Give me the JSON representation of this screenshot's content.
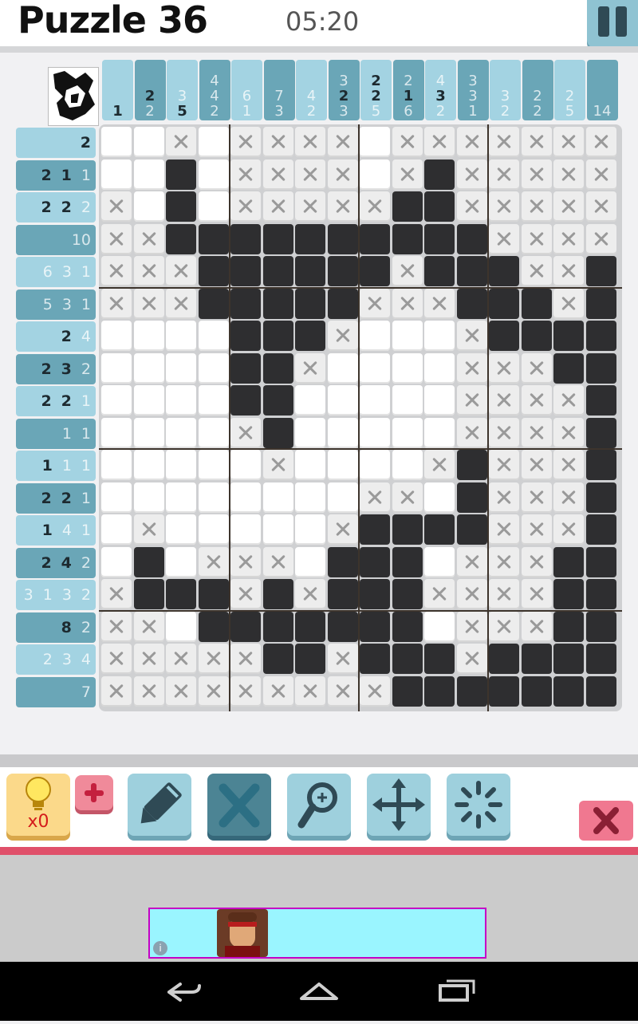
{
  "header": {
    "title": "Puzzle 36",
    "timer": "05:20"
  },
  "column_clues": [
    [
      "1"
    ],
    [
      "2",
      "2"
    ],
    [
      "3",
      "5"
    ],
    [
      "4",
      "4",
      "2"
    ],
    [
      "6",
      "1"
    ],
    [
      "7",
      "3"
    ],
    [
      "4",
      "2"
    ],
    [
      "3",
      "2",
      "3"
    ],
    [
      "2",
      "2",
      "5"
    ],
    [
      "2",
      "1",
      "6"
    ],
    [
      "4",
      "3",
      "2"
    ],
    [
      "3",
      "3",
      "1"
    ],
    [
      "3",
      "2"
    ],
    [
      "2",
      "2"
    ],
    [
      "2",
      "5"
    ],
    [
      "14"
    ]
  ],
  "column_clue_active": [
    [
      true
    ],
    [
      true,
      false
    ],
    [
      false,
      true
    ],
    [
      false,
      false,
      false
    ],
    [
      false,
      false
    ],
    [
      false,
      false
    ],
    [
      false,
      false
    ],
    [
      false,
      true,
      false
    ],
    [
      true,
      true,
      false
    ],
    [
      false,
      true,
      false
    ],
    [
      false,
      true,
      false
    ],
    [
      false,
      false,
      false
    ],
    [
      false,
      false
    ],
    [
      false,
      false
    ],
    [
      false,
      false
    ],
    [
      false
    ]
  ],
  "row_clues": [
    [
      "2"
    ],
    [
      "2",
      "1",
      "1"
    ],
    [
      "2",
      "2",
      "2"
    ],
    [
      "10"
    ],
    [
      "6",
      "3",
      "1"
    ],
    [
      "5",
      "3",
      "1"
    ],
    [
      "2",
      "4"
    ],
    [
      "2",
      "3",
      "2"
    ],
    [
      "2",
      "2",
      "1"
    ],
    [
      "1",
      "1"
    ],
    [
      "1",
      "1",
      "1"
    ],
    [
      "2",
      "2",
      "1"
    ],
    [
      "1",
      "4",
      "1"
    ],
    [
      "2",
      "4",
      "2"
    ],
    [
      "3",
      "1",
      "3",
      "2"
    ],
    [
      "8",
      "2"
    ],
    [
      "2",
      "3",
      "4"
    ],
    [
      "7"
    ]
  ],
  "row_clue_active": [
    [
      true
    ],
    [
      true,
      true,
      false
    ],
    [
      true,
      true,
      false
    ],
    [
      false
    ],
    [
      false,
      false,
      false
    ],
    [
      false,
      false,
      false
    ],
    [
      true,
      false
    ],
    [
      true,
      true,
      false
    ],
    [
      true,
      true,
      false
    ],
    [
      false,
      false
    ],
    [
      true,
      false,
      false
    ],
    [
      true,
      true,
      false
    ],
    [
      true,
      false,
      false
    ],
    [
      true,
      true,
      false
    ],
    [
      false,
      false,
      false,
      false
    ],
    [
      true,
      false
    ],
    [
      false,
      false,
      false
    ],
    [
      false
    ]
  ],
  "grid": [
    "EEXEXXXXEXXXXXXX",
    "EEFEXXXXEXFXXXXX",
    "XEFEXXXXXFFXXXXX",
    "XXFFFFFFFFFFXXXX",
    "XXXFFFFFFXFFFXXF",
    "XXXFFFFFXXXFFFXF",
    "EEEEFFFXEEEXFFFF",
    "EEEEFFXEEEEXXXFF",
    "EEEEFFEEEEEXXXXF",
    "EEEEXFEEEEEXXXXF",
    "EEEEEXEEEEXFXXXF",
    "EEEEEEEEXXEFXXXF",
    "EXEEEEEXFFFFXXXF",
    "EFEXXXEFFFEXXXFF",
    "XFFFXFXFFFXXXXFF",
    "XXEFFFFFFFEXXXFF",
    "XXXXXFFXFFFXFFFF",
    "XXXXXXXXXFFFFFFF"
  ],
  "cell_legend": {
    "E": "empty",
    "F": "filled",
    "X": "crossed"
  },
  "toolbar": {
    "hint_count": "x0",
    "tools": [
      "pencil-icon",
      "cross-icon",
      "magnifier-icon",
      "move-icon",
      "loading-icon"
    ],
    "active_tool": "cross-icon"
  },
  "colors": {
    "filled": "#2e2e30",
    "clue_bg_light": "#a3d3e2",
    "clue_bg_dark": "#6aa6b7",
    "accent_red": "#e0506a"
  }
}
